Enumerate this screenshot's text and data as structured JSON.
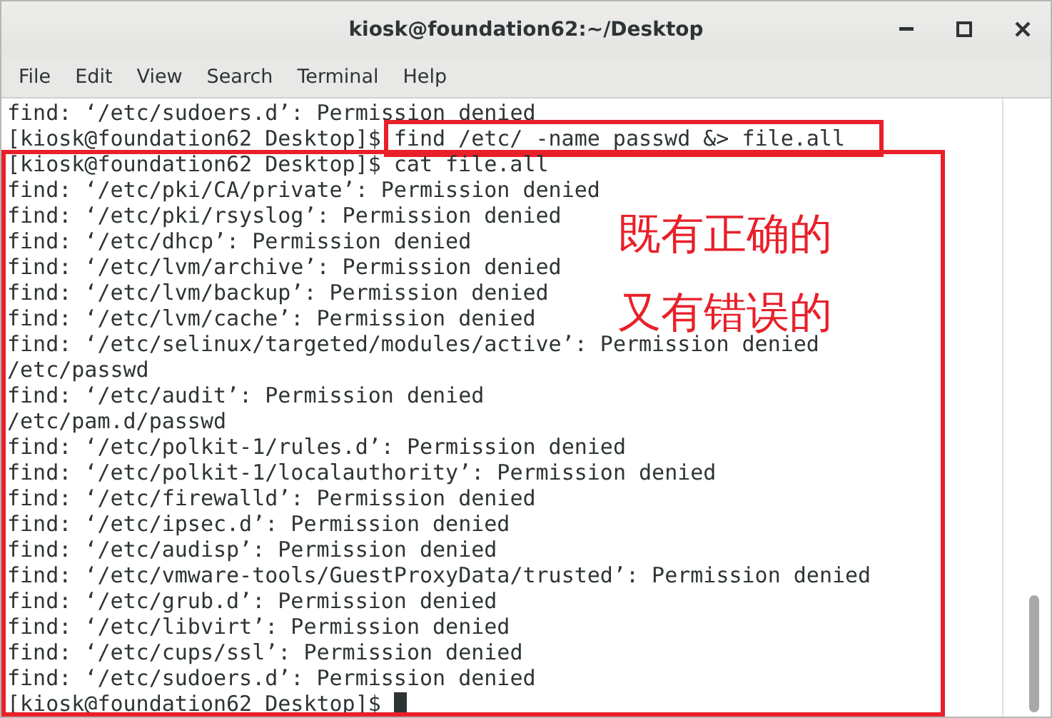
{
  "window": {
    "title": "kiosk@foundation62:~/Desktop"
  },
  "menu": [
    "File",
    "Edit",
    "View",
    "Search",
    "Terminal",
    "Help"
  ],
  "terminal": {
    "lines": [
      {
        "kind": "output",
        "text": "find: ‘/etc/sudoers.d’: Permission denied"
      },
      {
        "kind": "command",
        "prompt": "[kiosk@foundation62 Desktop]$",
        "command": "find /etc/ -name passwd &> file.all",
        "highlighted": true
      },
      {
        "kind": "command",
        "prompt": "[kiosk@foundation62 Desktop]$",
        "command": "cat file.all",
        "highlighted": false
      },
      {
        "kind": "output",
        "text": "find: ‘/etc/pki/CA/private’: Permission denied"
      },
      {
        "kind": "output",
        "text": "find: ‘/etc/pki/rsyslog’: Permission denied"
      },
      {
        "kind": "output",
        "text": "find: ‘/etc/dhcp’: Permission denied"
      },
      {
        "kind": "output",
        "text": "find: ‘/etc/lvm/archive’: Permission denied"
      },
      {
        "kind": "output",
        "text": "find: ‘/etc/lvm/backup’: Permission denied"
      },
      {
        "kind": "output",
        "text": "find: ‘/etc/lvm/cache’: Permission denied"
      },
      {
        "kind": "output",
        "text": "find: ‘/etc/selinux/targeted/modules/active’: Permission denied"
      },
      {
        "kind": "output",
        "text": "/etc/passwd"
      },
      {
        "kind": "output",
        "text": "find: ‘/etc/audit’: Permission denied"
      },
      {
        "kind": "output",
        "text": "/etc/pam.d/passwd"
      },
      {
        "kind": "output",
        "text": "find: ‘/etc/polkit-1/rules.d’: Permission denied"
      },
      {
        "kind": "output",
        "text": "find: ‘/etc/polkit-1/localauthority’: Permission denied"
      },
      {
        "kind": "output",
        "text": "find: ‘/etc/firewalld’: Permission denied"
      },
      {
        "kind": "output",
        "text": "find: ‘/etc/ipsec.d’: Permission denied"
      },
      {
        "kind": "output",
        "text": "find: ‘/etc/audisp’: Permission denied"
      },
      {
        "kind": "output",
        "text": "find: ‘/etc/vmware-tools/GuestProxyData/trusted’: Permission denied"
      },
      {
        "kind": "output",
        "text": "find: ‘/etc/grub.d’: Permission denied"
      },
      {
        "kind": "output",
        "text": "find: ‘/etc/libvirt’: Permission denied"
      },
      {
        "kind": "output",
        "text": "find: ‘/etc/cups/ssl’: Permission denied"
      },
      {
        "kind": "output",
        "text": "find: ‘/etc/sudoers.d’: Permission denied"
      }
    ],
    "prompt": "[kiosk@foundation62 Desktop]$ "
  },
  "annotation": {
    "notes": [
      "既有正确的",
      "又有错误的"
    ]
  }
}
